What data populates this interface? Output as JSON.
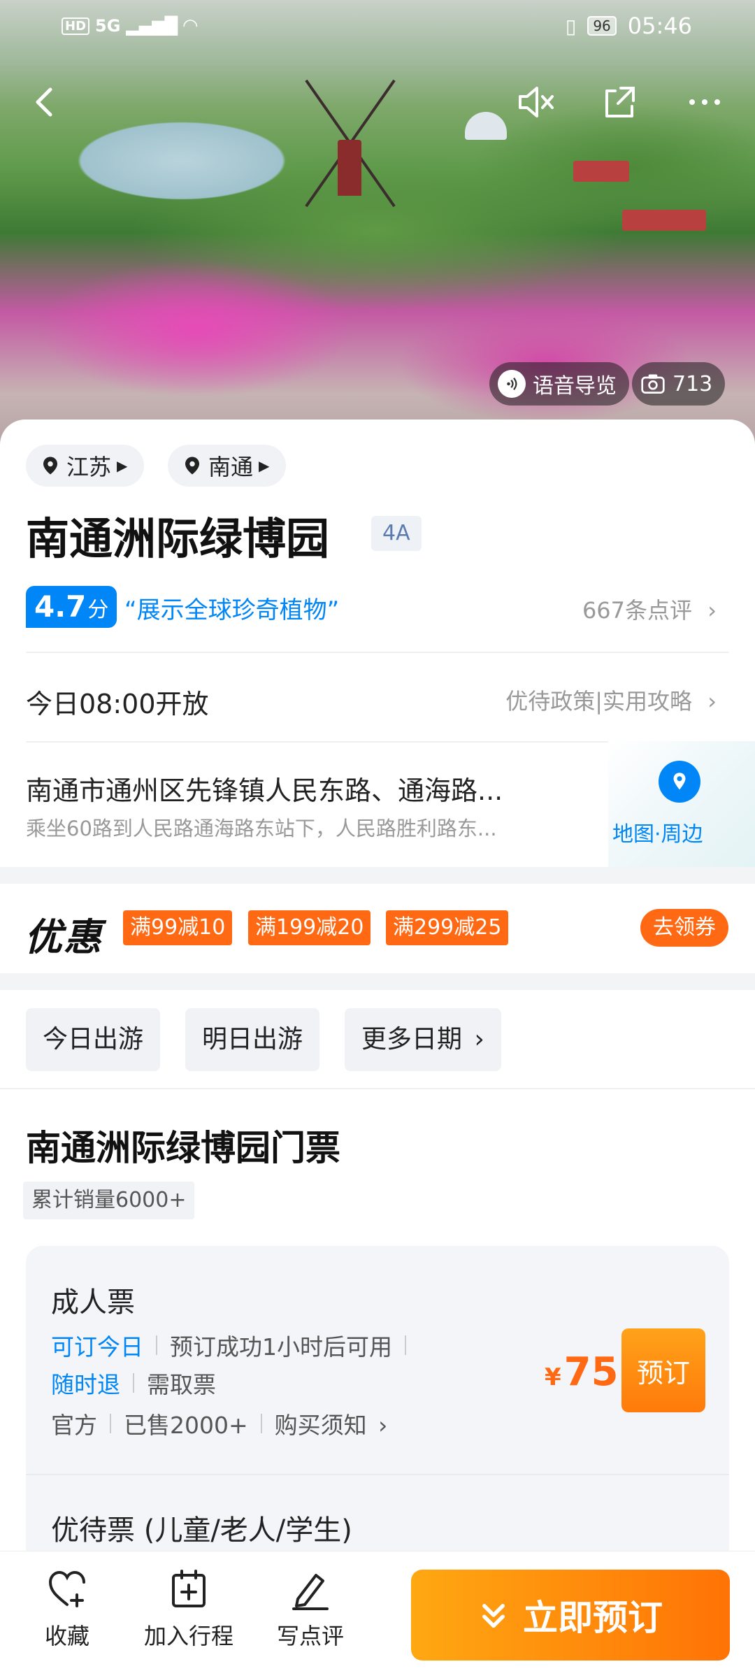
{
  "status_bar": {
    "network": "5G",
    "hd": "HD",
    "battery": "96",
    "time": "05:46"
  },
  "hero": {
    "audio_guide_label": "语音导览",
    "photo_count": "713"
  },
  "location": {
    "province": "江苏",
    "city": "南通"
  },
  "attraction": {
    "name": "南通洲际绿博园",
    "level": "4A",
    "score": "4.7",
    "score_unit": "分",
    "tagline": "“展示全球珍奇植物”",
    "reviews": "667条点评",
    "open_time": "今日08:00开放",
    "policy_link": "优待政策|实用攻略",
    "address": "南通市通州区先锋镇人民东路、通海路...",
    "transit": "乘坐60路到人民路通海路东站下，人民路胜利路东...",
    "map_label": "地图·周边"
  },
  "promo": {
    "title": "优惠",
    "coupons": [
      "满99减10",
      "满199减20",
      "满299减25"
    ],
    "get_coupon": "去领券"
  },
  "dates": {
    "today": "今日出游",
    "tomorrow": "明日出游",
    "more": "更多日期"
  },
  "tickets": {
    "section_title": "南通洲际绿博园门票",
    "sales": "累计销量6000+",
    "adult": {
      "name": "成人票",
      "tag_bookable": "可订今日",
      "tag_available": "预订成功1小时后可用",
      "tag_refund": "随时退",
      "tag_pickup": "需取票",
      "tag_official": "官方",
      "tag_sold": "已售2000+",
      "tag_notice": "购买须知",
      "currency": "¥",
      "price": "75",
      "book_label": "预订"
    },
    "concession": {
      "name": "优待票 (儿童/老人/学生)"
    }
  },
  "bottom_bar": {
    "favorite": "收藏",
    "add_trip": "加入行程",
    "review": "写点评",
    "book_now": "立即预订"
  },
  "colors": {
    "brand_blue": "#0086f6",
    "accent_orange": "#ff6913"
  }
}
